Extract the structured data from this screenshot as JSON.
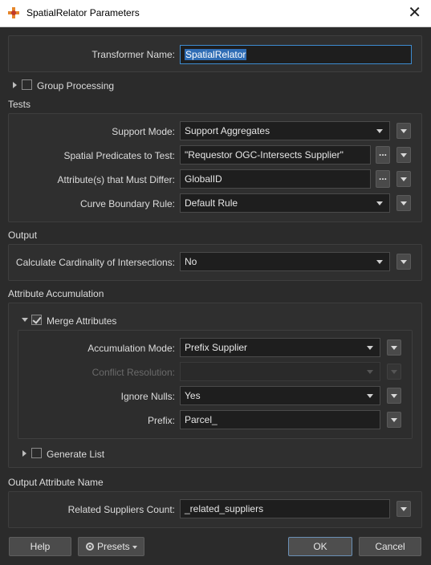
{
  "window": {
    "title": "SpatialRelator Parameters",
    "close_glyph": "✕"
  },
  "transformer_name": {
    "label": "Transformer Name:",
    "value": "SpatialRelator"
  },
  "group_processing": {
    "label": "Group Processing",
    "checked": false
  },
  "tests": {
    "section_title": "Tests",
    "support_mode": {
      "label": "Support Mode:",
      "value": "Support Aggregates"
    },
    "spatial_predicates": {
      "label": "Spatial Predicates to Test:",
      "value": "\"Requestor OGC-Intersects Supplier\"",
      "ellipsis": "..."
    },
    "attributes_differ": {
      "label": "Attribute(s) that Must Differ:",
      "value": "GlobalID",
      "ellipsis": "..."
    },
    "curve_boundary": {
      "label": "Curve Boundary Rule:",
      "value": "Default Rule"
    }
  },
  "output": {
    "section_title": "Output",
    "cardinality": {
      "label": "Calculate Cardinality of Intersections:",
      "value": "No"
    }
  },
  "attribute_accumulation": {
    "section_title": "Attribute Accumulation",
    "merge_attributes": {
      "label": "Merge Attributes",
      "checked": true
    },
    "accumulation_mode": {
      "label": "Accumulation Mode:",
      "value": "Prefix Supplier"
    },
    "conflict_resolution": {
      "label": "Conflict Resolution:",
      "value": ""
    },
    "ignore_nulls": {
      "label": "Ignore Nulls:",
      "value": "Yes"
    },
    "prefix": {
      "label": "Prefix:",
      "value": "Parcel_"
    },
    "generate_list": {
      "label": "Generate List",
      "checked": false
    }
  },
  "output_attribute_name": {
    "section_title": "Output Attribute Name",
    "related_suppliers_count": {
      "label": "Related Suppliers Count:",
      "value": "_related_suppliers"
    }
  },
  "footer": {
    "help_label": "Help",
    "presets_label": "Presets",
    "ok_label": "OK",
    "cancel_label": "Cancel"
  }
}
